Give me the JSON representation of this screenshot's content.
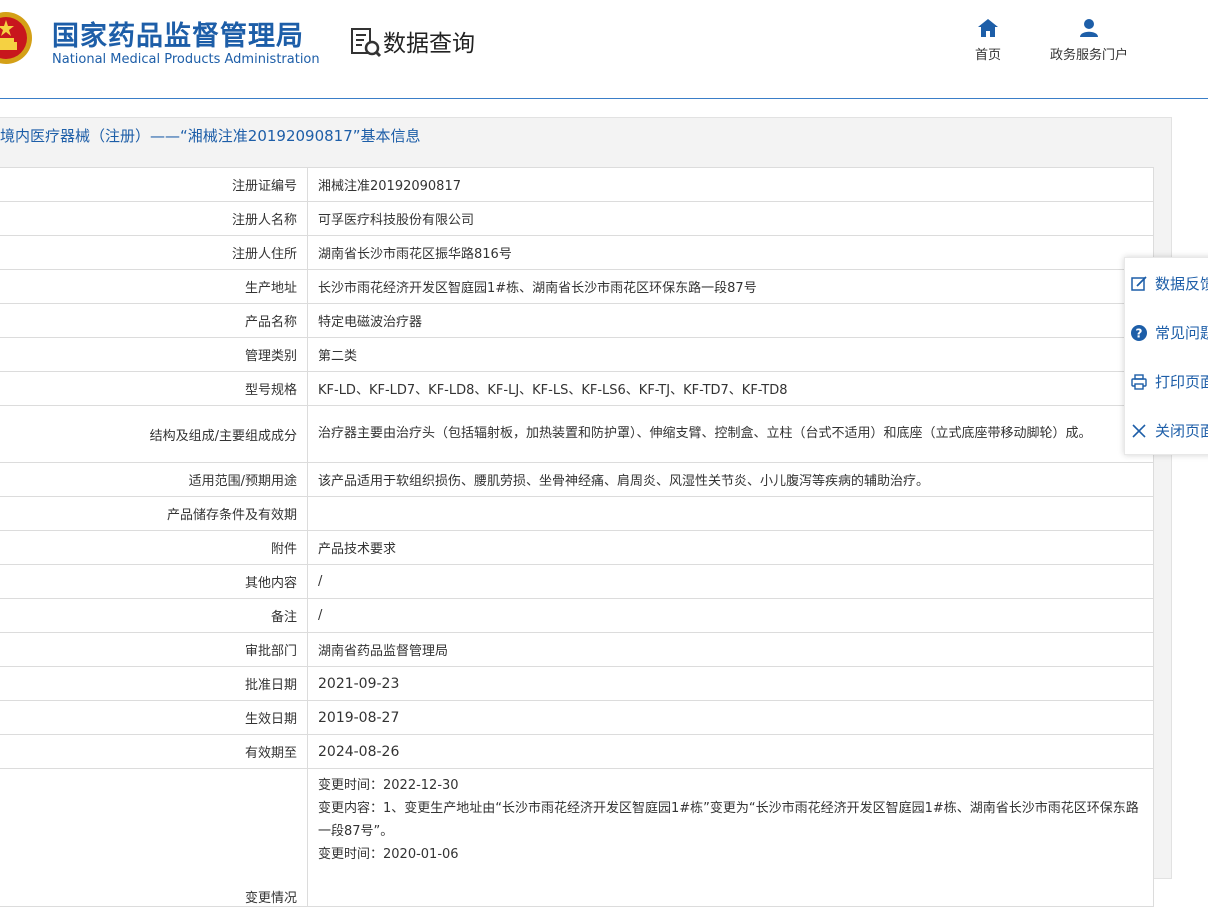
{
  "header": {
    "agency_cn": "国家药品监督管理局",
    "agency_en": "National Medical Products Administration",
    "query_title": "数据查询",
    "nav": [
      {
        "label": "首页",
        "icon": "home-icon"
      },
      {
        "label": "政务服务门户",
        "icon": "user-icon"
      }
    ]
  },
  "panel": {
    "title": "境内医疗器械（注册）——“湘械注准20192090817”基本信息"
  },
  "record": {
    "rows": [
      {
        "label": "注册证编号",
        "value": "湘械注准20192090817"
      },
      {
        "label": "注册人名称",
        "value": "可孚医疗科技股份有限公司"
      },
      {
        "label": "注册人住所",
        "value": "湖南省长沙市雨花区振华路816号"
      },
      {
        "label": "生产地址",
        "value": "长沙市雨花经济开发区智庭园1#栋、湖南省长沙市雨花区环保东路一段87号"
      },
      {
        "label": "产品名称",
        "value": "特定电磁波治疗器"
      },
      {
        "label": "管理类别",
        "value": "第二类"
      },
      {
        "label": "型号规格",
        "value": "KF-LD、KF-LD7、KF-LD8、KF-LJ、KF-LS、KF-LS6、KF-TJ、KF-TD7、KF-TD8"
      },
      {
        "label": "结构及组成/主要组成成分",
        "value": "治疗器主要由治疗头（包括辐射板，加热装置和防护罩）、伸缩支臂、控制盒、立柱（台式不适用）和底座（立式底座带移动脚轮）成。"
      },
      {
        "label": "适用范围/预期用途",
        "value": "该产品适用于软组织损伤、腰肌劳损、坐骨神经痛、肩周炎、风湿性关节炎、小儿腹泻等疾病的辅助治疗。"
      },
      {
        "label": "产品储存条件及有效期",
        "value": ""
      },
      {
        "label": "附件",
        "value": "产品技术要求"
      },
      {
        "label": "其他内容",
        "value": "/"
      },
      {
        "label": "备注",
        "value": "/"
      },
      {
        "label": "审批部门",
        "value": "湖南省药品监督管理局"
      },
      {
        "label": "批准日期",
        "value": "2021-09-23"
      },
      {
        "label": "生效日期",
        "value": "2019-08-27"
      },
      {
        "label": "有效期至",
        "value": "2024-08-26"
      }
    ],
    "change": {
      "label": "变更情况",
      "lines": [
        "变更时间：2022-12-30",
        "变更内容：1、变更生产地址由“长沙市雨花经济开发区智庭园1#栋”变更为“长沙市雨花经济开发区智庭园1#栋、湖南省长沙市雨花区环保东路一段87号”。",
        "变更时间：2020-01-06"
      ]
    }
  },
  "side_menu": [
    {
      "label": "数据反馈",
      "icon": "edit-icon"
    },
    {
      "label": "常见问题",
      "icon": "question-icon"
    },
    {
      "label": "打印页面",
      "icon": "print-icon"
    },
    {
      "label": "关闭页面",
      "icon": "close-icon"
    }
  ]
}
